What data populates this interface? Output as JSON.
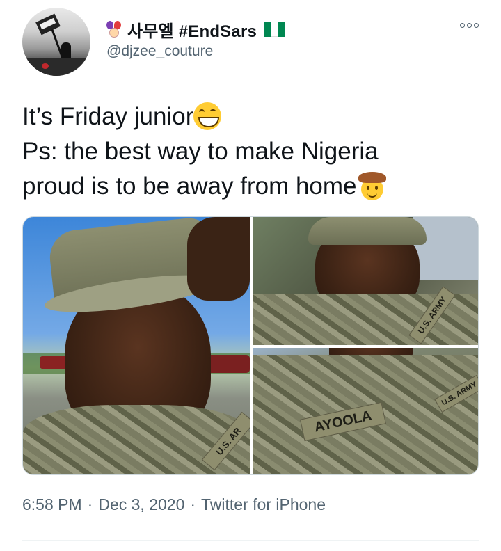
{
  "tweet": {
    "author": {
      "display_name": "사무엘 #EndSars",
      "handle": "@djzee_couture",
      "flag_colors": [
        "#008751",
        "#ffffff",
        "#008751"
      ]
    },
    "text_lines": [
      "It’s Friday junior",
      "Ps: the best way to make Nigeria",
      "proud is to be away from home"
    ],
    "media": {
      "photos": [
        {
          "tape_text": "U.S. AR"
        },
        {
          "tape_text": "U.S. ARMY"
        },
        {
          "name_tape": "AYOOLA",
          "tape_text": "U.S. ARMY"
        }
      ]
    },
    "meta": {
      "time": "6:58 PM",
      "date": "Dec 3, 2020",
      "source": "Twitter for iPhone",
      "separator": "·"
    }
  },
  "colors": {
    "text_primary": "#0f1419",
    "text_secondary": "#536471",
    "border": "#cfd9de"
  },
  "icons": [
    "jester-icon",
    "nigeria-flag-icon",
    "more-icon",
    "grinning-emoji",
    "cowboy-emoji"
  ]
}
